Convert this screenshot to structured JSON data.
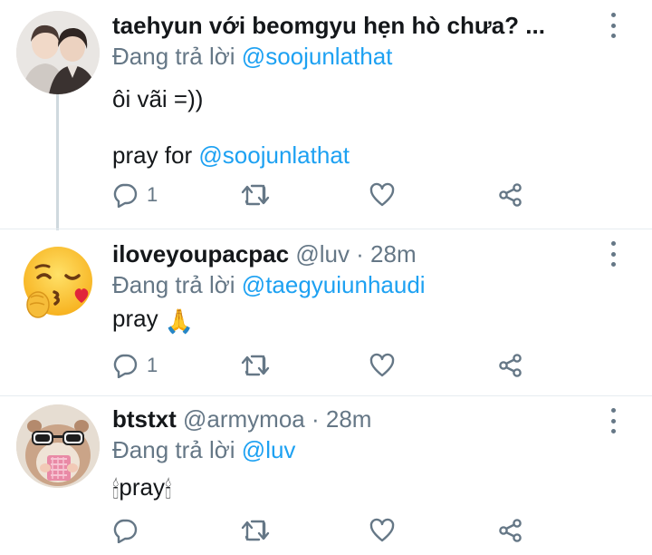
{
  "tweets": [
    {
      "display_name": "taehyun với beomgyu hẹn hò chưa? ...",
      "handle": "",
      "time": "",
      "reply_prefix": "Đang trả lời",
      "reply_to": "@soojunlathat",
      "body_line1": "ôi vãi =))",
      "body_line2_prefix": "pray for",
      "body_line2_mention": "@soojunlathat",
      "reply_count": "1",
      "avatar_icon": "two-people-photo"
    },
    {
      "display_name": "iloveyoupacpac",
      "handle": "@luv · 28m",
      "reply_prefix": "Đang trả lời",
      "reply_to": "@taegyuiunhaudi",
      "body_text": "pray",
      "body_emoji": "🙏",
      "reply_count": "1",
      "avatar_icon": "face-blowing-kiss-emoji"
    },
    {
      "display_name": "btstxt",
      "handle": "@armymoa · 28m",
      "reply_prefix": "Đang trả lời",
      "reply_to": "@luv",
      "body_text": "pray",
      "body_emoji_left": "🕯",
      "body_emoji_right": "🕯",
      "reply_count": "",
      "avatar_icon": "hamster-with-sunglasses-photo"
    }
  ],
  "colors": {
    "accent": "#1da1f2",
    "secondary_text": "#657786",
    "primary_text": "#14171a",
    "thread_line": "#cfd9de"
  },
  "icons": [
    "reply-icon",
    "retweet-icon",
    "like-icon",
    "share-icon",
    "more-options-icon"
  ]
}
